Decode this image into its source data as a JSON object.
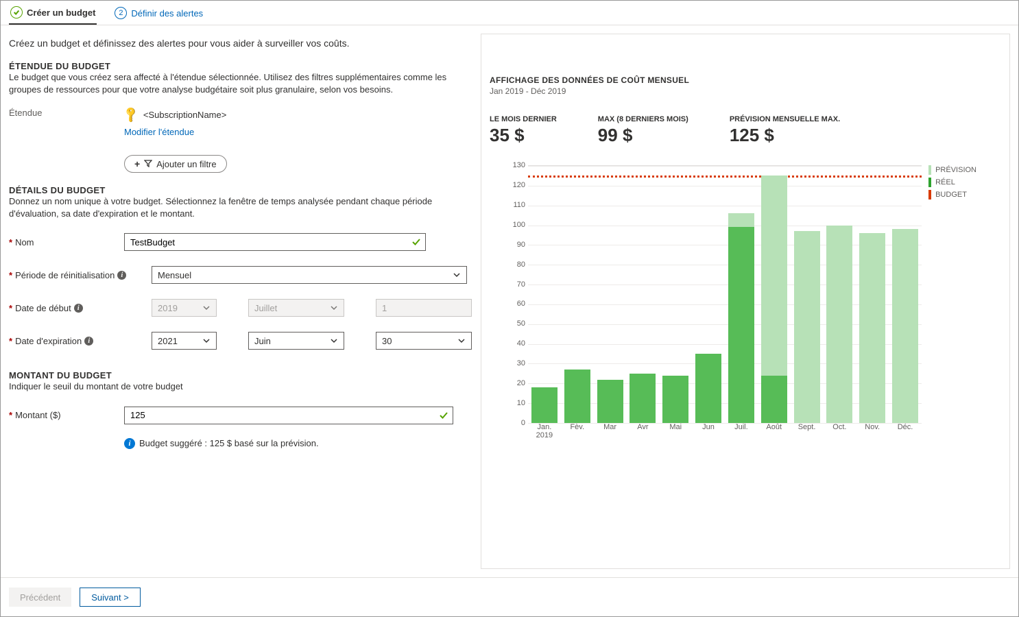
{
  "tabs": {
    "step1": "Créer un budget",
    "step2_number": "2",
    "step2": "Définir des alertes"
  },
  "intro": "Créez un budget et définissez des alertes pour vous aider à surveiller vos coûts.",
  "scope": {
    "heading": "ÉTENDUE DU BUDGET",
    "desc": "Le budget que vous créez sera affecté à l'étendue sélectionnée. Utilisez des filtres supplémentaires comme les groupes de ressources pour que votre analyse budgétaire soit plus granulaire, selon vos besoins.",
    "label": "Étendue",
    "value": "<SubscriptionName>",
    "modify_link": "Modifier l'étendue",
    "add_filter": "Ajouter un filtre"
  },
  "details": {
    "heading": "DÉTAILS DU BUDGET",
    "desc": "Donnez un nom unique à votre budget. Sélectionnez la fenêtre de temps analysée pendant chaque période d'évaluation, sa date d'expiration et le montant.",
    "name_label": "Nom",
    "name_value": "TestBudget",
    "reset_label": "Période de réinitialisation",
    "reset_value": "Mensuel",
    "start_label": "Date de début",
    "start_year": "2019",
    "start_month": "Juillet",
    "start_day": "1",
    "end_label": "Date d'expiration",
    "end_year": "2021",
    "end_month": "Juin",
    "end_day": "30"
  },
  "amount": {
    "heading": "MONTANT DU BUDGET",
    "desc": "Indiquer le seuil du montant de votre budget",
    "label": "Montant ($)",
    "value": "125",
    "suggest": "Budget suggéré : 125 $ basé sur la prévision."
  },
  "right": {
    "title": "AFFICHAGE DES DONNÉES DE COÛT MENSUEL",
    "period": "Jan 2019 - Déc 2019",
    "stat1_l": "LE MOIS DERNIER",
    "stat1_v": "35 $",
    "stat2_l": "MAX (8 DERNIERS MOIS)",
    "stat2_v": "99 $",
    "stat3_l": "PRÉVISION MENSUELLE MAX.",
    "stat3_v": "125 $",
    "legend": {
      "forecast": "PRÉVISION",
      "real": "RÉEL",
      "budget": "BUDGET"
    }
  },
  "chart_data": {
    "type": "bar",
    "categories": [
      "Jan. 2019",
      "Fèv.",
      "Mar",
      "Avr",
      "Mai",
      "Jun",
      "Juil.",
      "Août",
      "Sept.",
      "Oct.",
      "Nov.",
      "Déc."
    ],
    "series": [
      {
        "name": "PRÉVISION",
        "color": "#b7e1b7",
        "values": [
          18,
          27,
          22,
          25,
          24,
          35,
          106,
          125,
          97,
          100,
          96,
          98
        ]
      },
      {
        "name": "RÉEL",
        "color": "#57bc57",
        "values": [
          18,
          27,
          22,
          25,
          24,
          35,
          99,
          24,
          null,
          null,
          null,
          null
        ]
      }
    ],
    "budget_line": 125,
    "ylim": [
      0,
      130
    ],
    "yticks": [
      0,
      10,
      20,
      30,
      40,
      50,
      60,
      70,
      80,
      90,
      100,
      110,
      120,
      130
    ],
    "title": "AFFICHAGE DES DONNÉES DE COÛT MENSUEL",
    "xlabel": "",
    "ylabel": ""
  },
  "footer": {
    "prev": "Précédent",
    "next": "Suivant  >"
  }
}
